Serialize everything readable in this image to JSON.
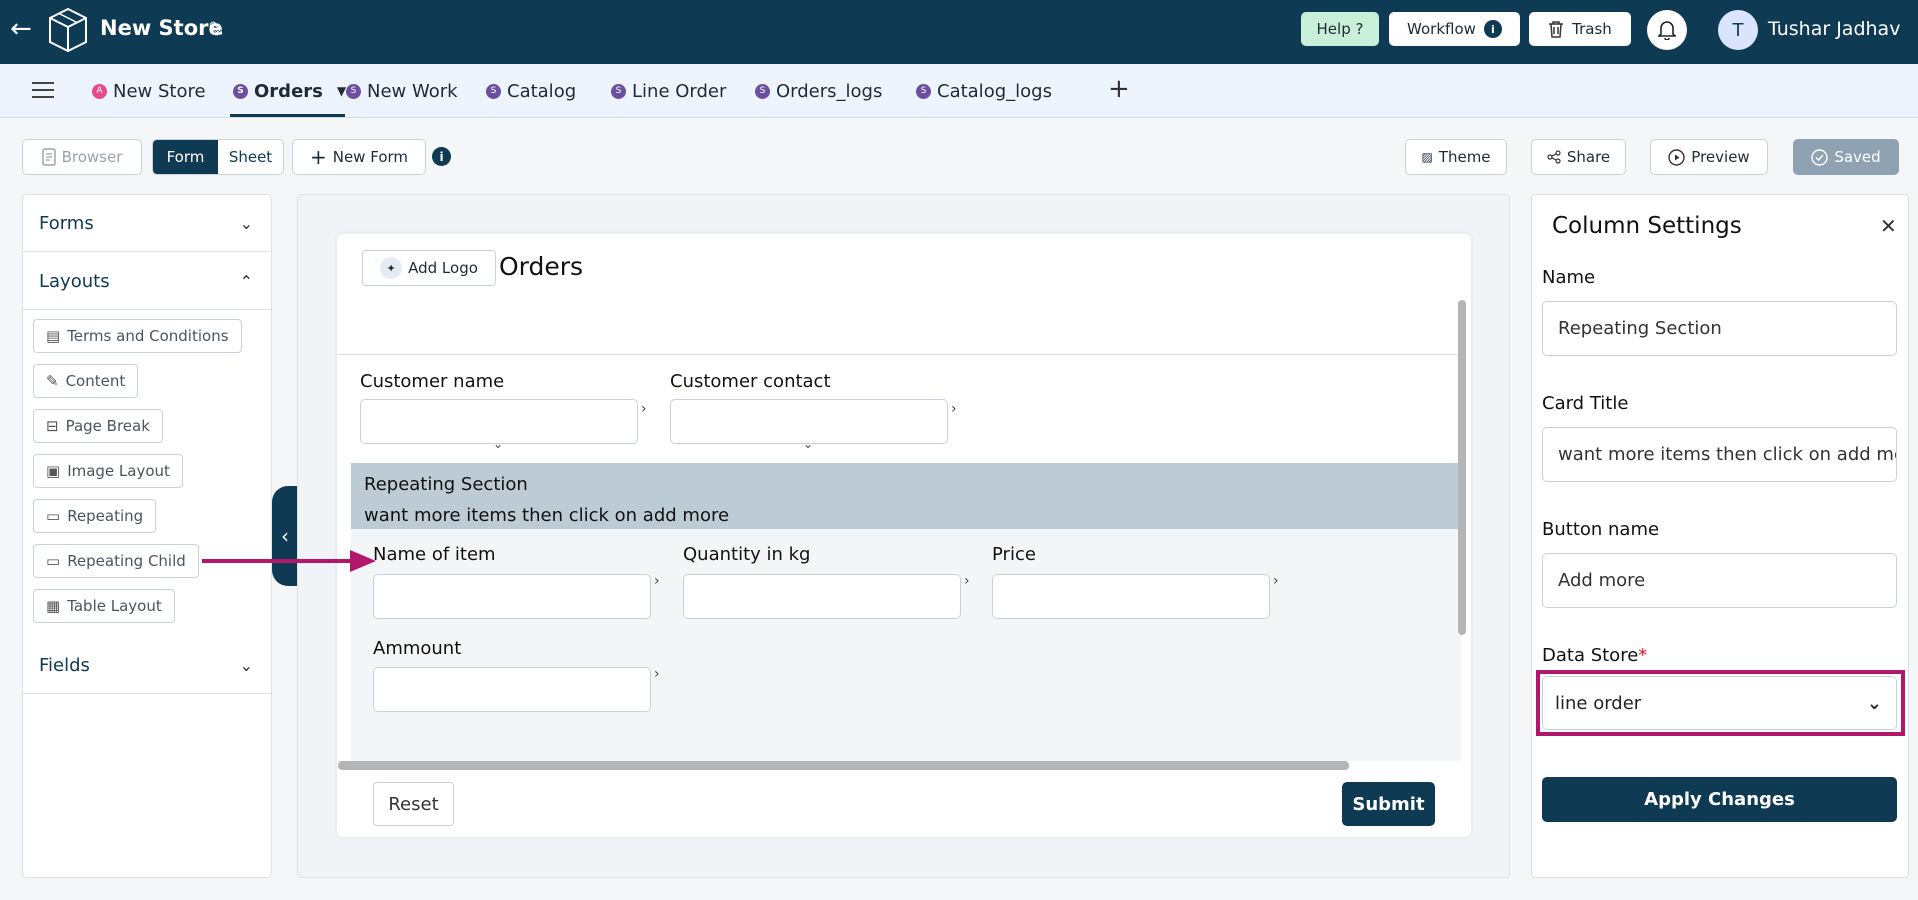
{
  "header": {
    "store_title": "New Store",
    "help_label": "Help ?",
    "workflow_label": "Workflow",
    "trash_label": "Trash",
    "avatar_initial": "T",
    "username": "Tushar Jadhav"
  },
  "tabs": [
    {
      "badge": "A",
      "label": "New Store"
    },
    {
      "badge": "S",
      "label": "Orders"
    },
    {
      "badge": "S",
      "label": "New Work"
    },
    {
      "badge": "S",
      "label": "Catalog"
    },
    {
      "badge": "S",
      "label": "Line Order"
    },
    {
      "badge": "S",
      "label": "Orders_logs"
    },
    {
      "badge": "S",
      "label": "Catalog_logs"
    }
  ],
  "toolbar": {
    "browser_label": "Browser",
    "form_label": "Form",
    "sheet_label": "Sheet",
    "new_form_label": "New Form",
    "info_glyph": "i",
    "theme_label": "Theme",
    "share_label": "Share",
    "preview_label": "Preview",
    "saved_label": "Saved"
  },
  "left_panel": {
    "forms_label": "Forms",
    "layouts_label": "Layouts",
    "fields_label": "Fields",
    "layout_items": [
      "Terms and Conditions",
      "Content",
      "Page Break",
      "Image Layout",
      "Repeating",
      "Repeating Child",
      "Table Layout"
    ]
  },
  "form": {
    "add_logo_label": "Add Logo",
    "title": "Orders",
    "customer_name_label": "Customer name",
    "customer_contact_label": "Customer contact",
    "repeating_title": "Repeating Section",
    "repeating_subtitle": "want more items then click on add more",
    "name_of_item_label": "Name of item",
    "quantity_label": "Quantity in kg",
    "price_label": "Price",
    "amount_label": "Ammount",
    "reset_label": "Reset",
    "submit_label": "Submit"
  },
  "column_settings": {
    "title": "Column Settings",
    "name_label": "Name",
    "name_value": "Repeating Section",
    "card_title_label": "Card Title",
    "card_title_value": "want more items then click on add more",
    "button_name_label": "Button name",
    "button_name_value": "Add more",
    "data_store_label": "Data Store",
    "required_mark": "*",
    "data_store_value": "line order",
    "apply_label": "Apply Changes"
  },
  "colors": {
    "brand": "#0e3a53",
    "highlight": "#b3176b",
    "help_bg": "#c8f0d9",
    "repeating_header_bg": "#bccbd4"
  }
}
